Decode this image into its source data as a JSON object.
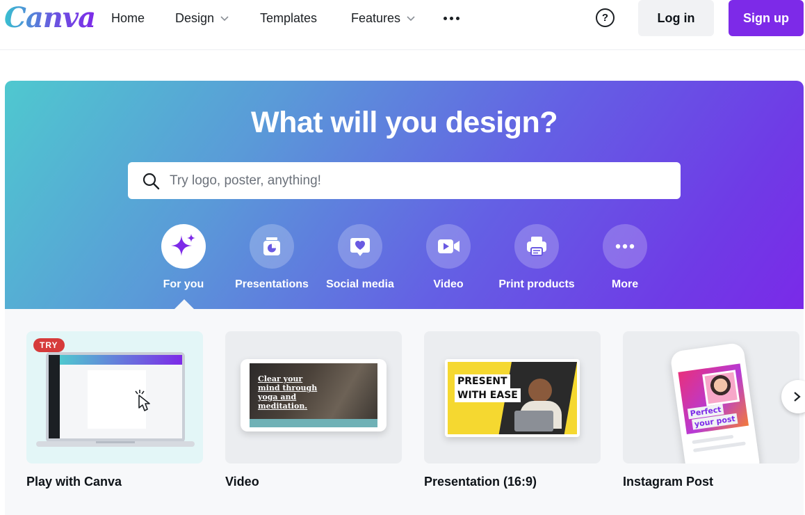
{
  "brand": {
    "logo_text": "Canva",
    "accent": "#7d2ae8"
  },
  "nav": {
    "home": "Home",
    "design": "Design",
    "templates": "Templates",
    "features": "Features",
    "login": "Log in",
    "signup": "Sign up",
    "help": "?"
  },
  "hero": {
    "title": "What will you design?",
    "search_placeholder": "Try logo, poster, anything!"
  },
  "categories": [
    {
      "label": "For you",
      "icon": "sparkle-icon",
      "active": true
    },
    {
      "label": "Presentations",
      "icon": "presentation-icon",
      "active": false
    },
    {
      "label": "Social media",
      "icon": "heart-chat-icon",
      "active": false
    },
    {
      "label": "Video",
      "icon": "video-camera-icon",
      "active": false
    },
    {
      "label": "Print products",
      "icon": "printer-icon",
      "active": false
    },
    {
      "label": "More",
      "icon": "more-dots-icon",
      "active": false
    }
  ],
  "cards": [
    {
      "title": "Play with Canva",
      "badge": "TRY"
    },
    {
      "title": "Video",
      "thumb_text": "Clear your mind through yoga and meditation."
    },
    {
      "title": "Presentation (16:9)",
      "thumb_text_1": "PRESENT",
      "thumb_text_2": "WITH EASE"
    },
    {
      "title": "Instagram Post",
      "thumb_text_1": "Perfect",
      "thumb_text_2": "your post"
    }
  ]
}
